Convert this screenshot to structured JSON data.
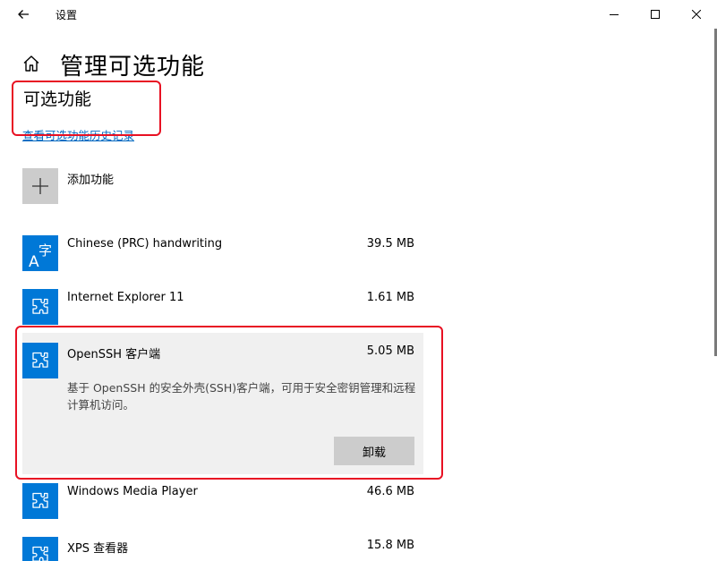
{
  "window": {
    "app_title": "设置",
    "page_title": "管理可选功能"
  },
  "section": {
    "title": "可选功能",
    "history_link": "查看可选功能历史记录"
  },
  "add_feature": {
    "label": "添加功能"
  },
  "features": [
    {
      "name": "Chinese (PRC) handwriting",
      "size": "39.5 MB",
      "icon": "chinese-handwriting-icon"
    },
    {
      "name": "Internet Explorer 11",
      "size": "1.61 MB",
      "icon": "puzzle-icon"
    },
    {
      "name": "OpenSSH 客户端",
      "size": "5.05 MB",
      "icon": "puzzle-icon",
      "description": "基于 OpenSSH 的安全外壳(SSH)客户端，可用于安全密钥管理和远程计算机访问。",
      "action_label": "卸载"
    },
    {
      "name": "Windows Media Player",
      "size": "46.6 MB",
      "icon": "puzzle-icon"
    },
    {
      "name": "XPS 查看器",
      "size": "15.8 MB",
      "icon": "puzzle-icon"
    }
  ],
  "colors": {
    "accent": "#0078d7",
    "link": "#0067c0",
    "highlight_box": "#e81123",
    "expanded_bg": "#f0f0f0"
  }
}
